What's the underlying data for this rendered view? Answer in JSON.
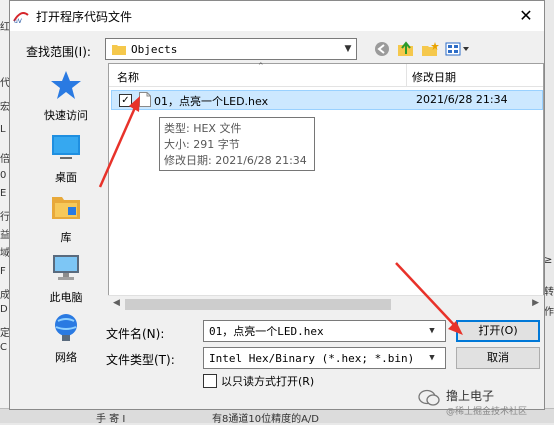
{
  "window": {
    "title": "打开程序代码文件"
  },
  "background": {
    "left_fragments": [
      "红",
      "代",
      "宏",
      "L",
      "倍",
      "0",
      "E",
      "行",
      "益",
      "域",
      "F",
      "成",
      "D",
      "定",
      "C"
    ],
    "bottom_fragments": [
      "手 寄 Ⅰ",
      "有8通道10位精度的A/D"
    ],
    "right_fragments": [
      "≥",
      "转",
      "作"
    ]
  },
  "lookin": {
    "label": "查找范围(I):",
    "value": "Objects"
  },
  "toolbar": {
    "icons": [
      "back-icon",
      "up-folder-icon",
      "new-folder-icon",
      "view-menu-icon"
    ]
  },
  "places": [
    {
      "label": "快速访问",
      "icon": "quick-access-icon"
    },
    {
      "label": "桌面",
      "icon": "desktop-icon"
    },
    {
      "label": "库",
      "icon": "library-icon"
    },
    {
      "label": "此电脑",
      "icon": "this-pc-icon"
    },
    {
      "label": "网络",
      "icon": "network-icon"
    }
  ],
  "filelist": {
    "columns": {
      "name": "名称",
      "date": "修改日期"
    },
    "rows": [
      {
        "name": "01，点亮一个LED.hex",
        "date": "2021/6/28 21:34",
        "checked": true,
        "selected": true
      }
    ],
    "tooltip": {
      "type": "类型: HEX 文件",
      "size": "大小: 291 字节",
      "modified": "修改日期: 2021/6/28 21:34"
    }
  },
  "filename": {
    "label": "文件名(N):",
    "value": "01，点亮一个LED.hex"
  },
  "filetype": {
    "label": "文件类型(T):",
    "value": "Intel Hex/Binary (*.hex; *.bin)"
  },
  "readonly": {
    "label": "以只读方式打开(R)"
  },
  "buttons": {
    "open": "打开(O)",
    "cancel": "取消"
  },
  "watermark": {
    "name": "撸上电子",
    "sub": "@稀土掘金技术社区"
  },
  "colors": {
    "selection": "#cce8ff",
    "accent": "#0078d7",
    "arrow": "#e8322a"
  }
}
